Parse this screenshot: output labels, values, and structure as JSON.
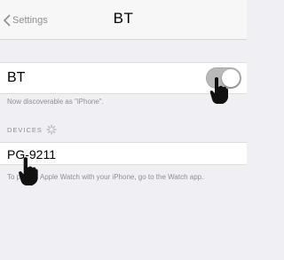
{
  "navbar": {
    "back_label": "Settings",
    "title": "BT"
  },
  "bt_row": {
    "label": "BT",
    "toggle_on": true
  },
  "discoverable_text": "Now discoverable as \"iPhone\".",
  "devices_header": "DEVICES",
  "device": {
    "name": "PG-9211"
  },
  "watch_text": "To pair an Apple Watch with your iPhone, go to the Watch app.",
  "colors": {
    "background": "#efeff4",
    "caption": "#8e8e93",
    "toggle": "#b9b9b9"
  },
  "icons": {
    "back": "chevron-left-icon",
    "spinner": "spinner-icon",
    "hand": "pointing-hand-icon"
  }
}
